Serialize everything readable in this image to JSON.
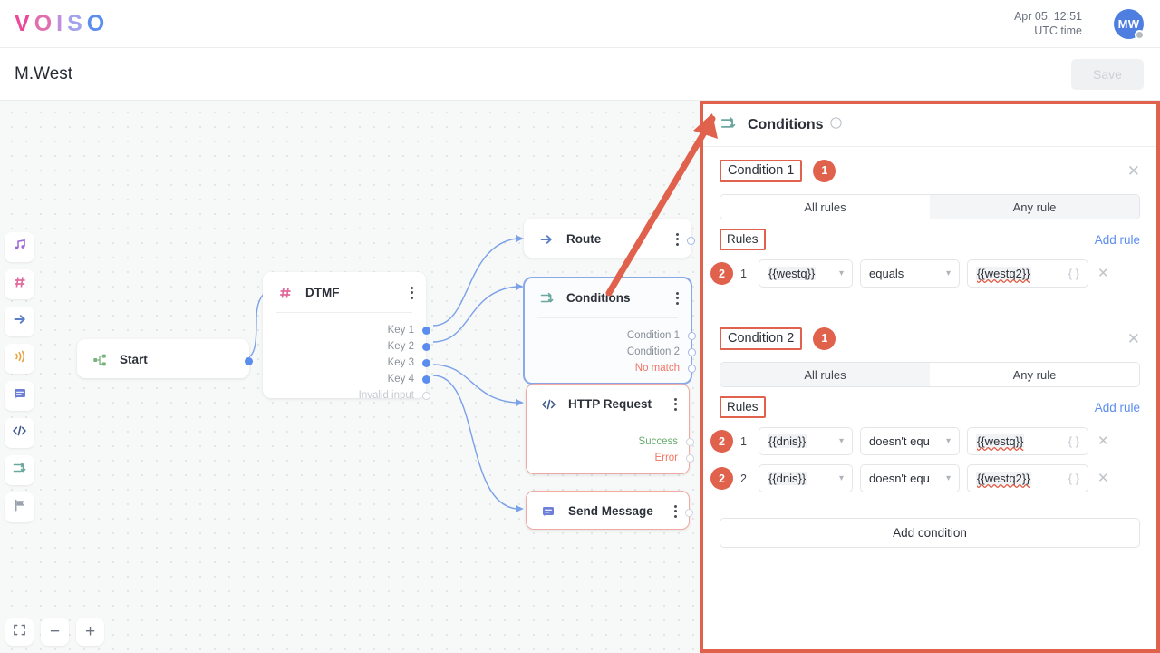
{
  "header": {
    "logo_letters": [
      "V",
      "O",
      "I",
      "S",
      "O"
    ],
    "datetime": "Apr 05, 12:51",
    "timezone_label": "UTC time",
    "avatar_initials": "MW"
  },
  "subheader": {
    "flow_title": "M.West",
    "save_label": "Save"
  },
  "palette": {
    "items": [
      {
        "icon": "music-note-icon",
        "color": "#a06bd6"
      },
      {
        "icon": "hash-dtmf-icon",
        "color": "#e06a9c"
      },
      {
        "icon": "arrow-route-icon",
        "color": "#5b7fc7"
      },
      {
        "icon": "sound-wave-icon",
        "color": "#e9a23b"
      },
      {
        "icon": "message-icon",
        "color": "#6d7fd8"
      },
      {
        "icon": "code-icon",
        "color": "#3f5a8c"
      },
      {
        "icon": "conditions-icon",
        "color": "#6aa79e"
      },
      {
        "icon": "flag-icon",
        "color": "#9ba1ad"
      }
    ]
  },
  "zoom_toolbar": {
    "fit_label": "fit-to-screen-icon",
    "zoom_out_label": "−",
    "zoom_in_label": "+"
  },
  "canvas": {
    "nodes": [
      {
        "id": "start",
        "title": "Start",
        "icon": "start-flow-icon",
        "ports": []
      },
      {
        "id": "dtmf",
        "title": "DTMF",
        "icon": "hash-dtmf-icon",
        "ports": [
          {
            "label": "Key 1",
            "style": "filled"
          },
          {
            "label": "Key 2",
            "style": "filled"
          },
          {
            "label": "Key 3",
            "style": "filled"
          },
          {
            "label": "Key 4",
            "style": "filled"
          },
          {
            "label": "Invalid input",
            "style": "hollow"
          }
        ]
      },
      {
        "id": "route",
        "title": "Route",
        "icon": "arrow-route-icon",
        "ports": []
      },
      {
        "id": "conditions",
        "title": "Conditions",
        "icon": "conditions-icon",
        "selected": true,
        "ports": [
          {
            "label": "Condition 1",
            "style": "hollow-blue"
          },
          {
            "label": "Condition 2",
            "style": "hollow-blue"
          },
          {
            "label": "No match",
            "style": "hollow-blue",
            "tone": "nomatch"
          }
        ]
      },
      {
        "id": "http-request",
        "title": "HTTP Request",
        "icon": "code-icon",
        "error": true,
        "ports": [
          {
            "label": "Success",
            "style": "hollow",
            "tone": "ok"
          },
          {
            "label": "Error",
            "style": "hollow",
            "tone": "err"
          }
        ]
      },
      {
        "id": "send-message",
        "title": "Send Message",
        "icon": "message-icon",
        "error": true,
        "ports": [
          {
            "label": "",
            "style": "hollow"
          }
        ]
      }
    ]
  },
  "panel": {
    "title": "Conditions",
    "icon": "conditions-icon",
    "info_icon": "info-icon",
    "add_condition_label": "Add condition",
    "conditions": [
      {
        "name": "Condition 1",
        "badge": "1",
        "mode_options": [
          "All rules",
          "Any rule"
        ],
        "mode_selected": "All rules",
        "rules_label": "Rules",
        "add_rule_label": "Add rule",
        "rules": [
          {
            "badge": "2",
            "index": "1",
            "variable": "{{westq}}",
            "operator": "equals",
            "value": "{{westq2}}",
            "value_spellcheck": true,
            "braces_icon": "{ }"
          }
        ]
      },
      {
        "name": "Condition 2",
        "badge": "1",
        "mode_options": [
          "All rules",
          "Any rule"
        ],
        "mode_selected": "Any rule",
        "rules_label": "Rules",
        "add_rule_label": "Add rule",
        "rules": [
          {
            "badge": "2",
            "index": "1",
            "variable": "{{dnis}}",
            "operator": "doesn't equ",
            "value": "{{westq}}",
            "value_spellcheck": true,
            "braces_icon": "{ }"
          },
          {
            "badge": "2",
            "index": "2",
            "variable": "{{dnis}}",
            "operator": "doesn't equ",
            "value": "{{westq2}}",
            "value_spellcheck": true,
            "braces_icon": "{ }"
          }
        ]
      }
    ]
  },
  "annotations": {
    "accent_color": "#e0614c",
    "arrow": "points from Conditions node to panel header"
  }
}
